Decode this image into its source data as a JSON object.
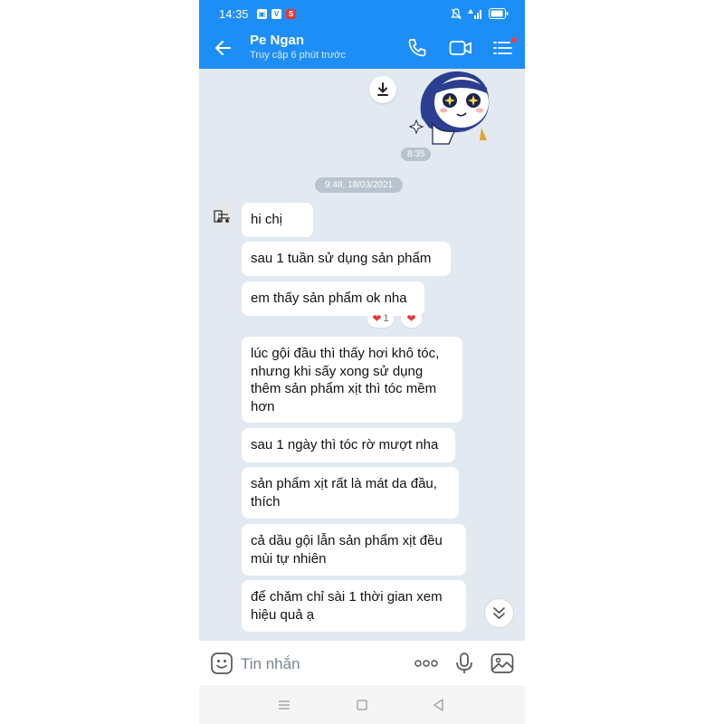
{
  "status_bar": {
    "time": "14:35",
    "icons": [
      "gallery-icon",
      "vtv-icon",
      "s-app-icon",
      "mute-icon",
      "wifi-signal-icon",
      "battery-icon"
    ]
  },
  "header": {
    "contact_name": "Pe Ngan",
    "contact_status": "Truy cập 6 phút trước",
    "icons": [
      "back-arrow-icon",
      "phone-call-icon",
      "video-call-icon",
      "menu-list-icon"
    ],
    "accent_color": "#1e8ef7"
  },
  "chat": {
    "sticker_time": "8:35",
    "date_separator": "9:48, 18/03/2021",
    "messages": [
      {
        "text": "hi chị"
      },
      {
        "text": "sau 1 tuần sử dụng sản phẩm"
      },
      {
        "text": "em thấy sản phẩm ok nha"
      },
      {
        "text": "lúc gội đầu thì thấy hơi khô tóc, nhưng khi sấy xong sử dụng thêm sản phẩm xịt thì tóc mềm hơn"
      },
      {
        "text": "sau 1 ngày thì tóc rờ mượt nha"
      },
      {
        "text": "sản phẩm xịt rất là mát da đầu, thích"
      },
      {
        "text": "cả dầu gội lẫn sản phẩm xịt đều mùi tự nhiên"
      },
      {
        "text": "để chăm chỉ sài 1 thời gian xem hiệu quả ạ"
      }
    ],
    "reaction_count": "1"
  },
  "input_bar": {
    "placeholder": "Tin nhắn",
    "icons": [
      "emoji-icon",
      "more-dots-icon",
      "microphone-icon",
      "image-icon"
    ]
  },
  "nav_bar": {
    "icons": [
      "recent-apps-icon",
      "home-icon",
      "back-icon"
    ]
  }
}
